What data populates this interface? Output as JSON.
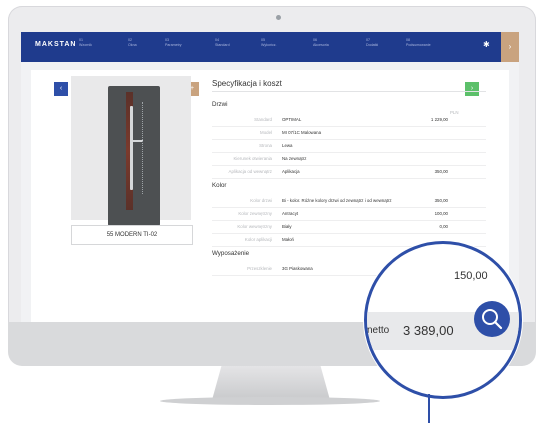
{
  "app": {
    "brand": "MAKSTAN"
  },
  "nav": {
    "items": [
      "Wzornik",
      "Okna",
      "Parametry",
      "Standard",
      "Wykończ.",
      "Akcesoria",
      "Dodatki",
      "Podsumowanie"
    ],
    "numbers": [
      "01",
      "02",
      "03",
      "04",
      "05",
      "06",
      "07",
      "08"
    ]
  },
  "product": {
    "name": "55 MODERN TI-02"
  },
  "spec": {
    "title": "Specyfikacja i koszt",
    "currency": "PLN",
    "sections": {
      "drzwi": "Drzwi",
      "kolor": "Kolor",
      "wyposazenie": "Wyposażenie"
    },
    "drzwi_rows": [
      {
        "label": "Standard",
        "value": "OPTIMAL",
        "price": "1 229,00"
      },
      {
        "label": "Model",
        "value": "MI 07/1C Malowana",
        "price": ""
      },
      {
        "label": "Strona",
        "value": "Lewa",
        "price": ""
      },
      {
        "label": "Kierunek otwierania",
        "value": "Na zewnątrz",
        "price": ""
      },
      {
        "label": "Aplikacja od wewnątrz",
        "value": "Aplikacja",
        "price": "350,00"
      }
    ],
    "kolor_rows": [
      {
        "label": "Kolor drzwi",
        "value": "Bi - kolor. Różne kolory drzwi od zewnątrz i od wewnątrz",
        "price": "350,00"
      },
      {
        "label": "Kolor zewnętrzny",
        "value": "Antracyt",
        "price": "100,00"
      },
      {
        "label": "Kolor wewnętrzny",
        "value": "Biały",
        "price": "0,00"
      },
      {
        "label": "Kolor aplikacji",
        "value": "Małoń",
        "price": ""
      }
    ],
    "wyposazenie_rows": [
      {
        "label": "Przeszklenie",
        "value": "3G Piaskowana",
        "price": ""
      }
    ]
  },
  "magnifier": {
    "value": "150,00",
    "total_label": "netto",
    "total": "3 389,00"
  },
  "colors": {
    "accent": "#2e4fa8",
    "nav": "#1f3b8d",
    "gold": "#c9a37f",
    "green": "#5cc06a"
  }
}
